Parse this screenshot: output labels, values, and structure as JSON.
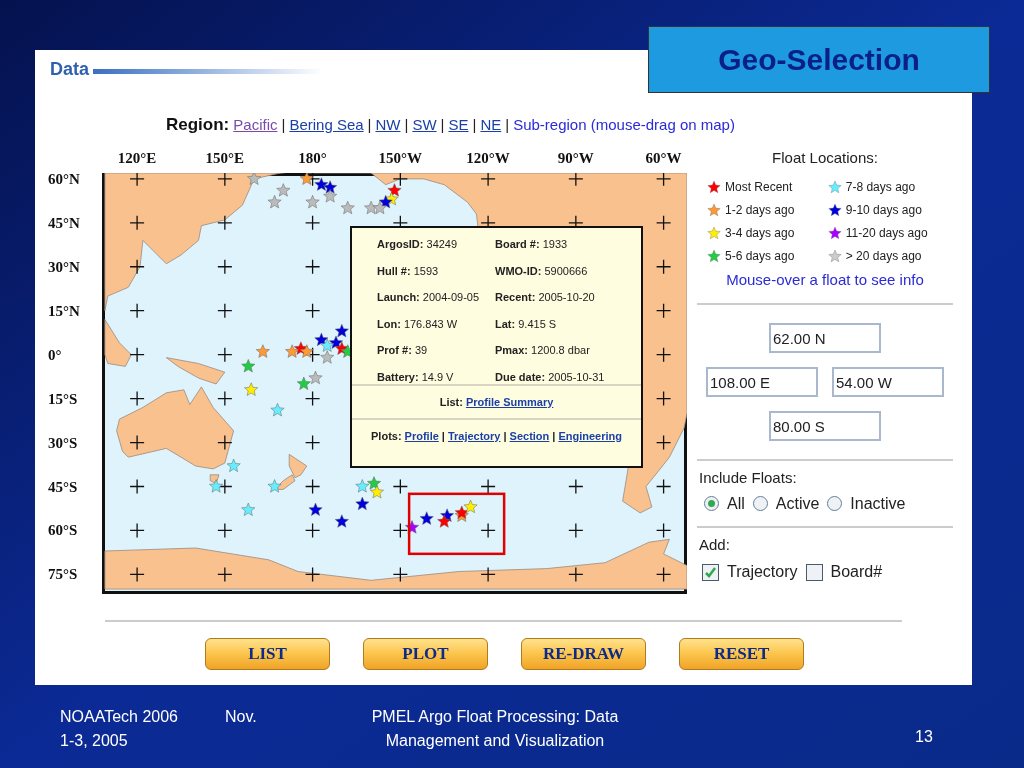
{
  "slide_title": "Geo-Selection",
  "panel": {
    "title": "Data"
  },
  "region": {
    "label": "Region:",
    "links": [
      {
        "text": "Pacific",
        "visited": true
      },
      {
        "text": "Bering Sea",
        "visited": false
      },
      {
        "text": "NW",
        "visited": false
      },
      {
        "text": "SW",
        "visited": false
      },
      {
        "text": "SE",
        "visited": false
      },
      {
        "text": "NE",
        "visited": false
      }
    ],
    "separator": "|",
    "hint": "Sub-region (mouse-drag on map)"
  },
  "map": {
    "lon_labels": [
      "120°E",
      "150°E",
      "180°",
      "150°W",
      "120°W",
      "90°W",
      "60°W"
    ],
    "lat_labels": [
      "60°N",
      "45°N",
      "30°N",
      "15°N",
      "0°",
      "15°S",
      "30°S",
      "45°S",
      "60°S",
      "75°S"
    ]
  },
  "popup": {
    "fields": [
      "**ArgosID:** 34249",
      "**Board #:** 1933",
      "**Hull #:** 1593",
      "**WMO-ID:** 5900666",
      "**Launch:** 2004-09-05",
      "**Recent:** 2005-10-20",
      "**Lon:** 176.843 W",
      "**Lat:** 9.415 S",
      "**Prof #:** 39",
      "**Pmax:** 1200.8 dbar",
      "**Battery:** 14.9 V",
      "**Due date:** 2005-10-31"
    ],
    "list": {
      "label": "List:",
      "links": [
        "Profile Summary"
      ]
    },
    "plots": {
      "label": "Plots:",
      "separator": "|",
      "links": [
        "Profile",
        "Trajectory",
        "Section",
        "Engineering"
      ]
    }
  },
  "legend": {
    "title": "Float Locations:",
    "items": [
      {
        "label": "Most Recent",
        "color": "#ff0000"
      },
      {
        "label": "1-2 days ago",
        "color": "#ff9933"
      },
      {
        "label": "3-4 days ago",
        "color": "#ffee00"
      },
      {
        "label": "5-6 days ago",
        "color": "#22cc44"
      },
      {
        "label": "7-8 days ago",
        "color": "#66eeff"
      },
      {
        "label": "9-10 days ago",
        "color": "#0000dd"
      },
      {
        "label": "11-20 days ago",
        "color": "#aa00ff"
      },
      {
        "label": "> 20 days ago",
        "color": "#cccccc"
      }
    ],
    "hint": "Mouse-over a float to see info"
  },
  "bounds": {
    "north": "62.00 N",
    "west": "108.00 E",
    "east": "54.00 W",
    "south": "80.00 S"
  },
  "include": {
    "label": "Include Floats:",
    "options": [
      {
        "label": "All",
        "selected": true
      },
      {
        "label": "Active",
        "selected": false
      },
      {
        "label": "Inactive",
        "selected": false
      }
    ]
  },
  "add": {
    "label": "Add:",
    "options": [
      {
        "label": "Trajectory",
        "checked": true
      },
      {
        "label": "Board#",
        "checked": false
      }
    ]
  },
  "buttons": [
    "LIST",
    "PLOT",
    "RE-DRAW",
    "RESET"
  ],
  "footer": {
    "left": [
      "NOAATech 2006",
      "1-3, 2005"
    ],
    "middle": "Nov.",
    "title": "PMEL Argo Float Processing: Data Management and Visualization",
    "page": "13"
  }
}
